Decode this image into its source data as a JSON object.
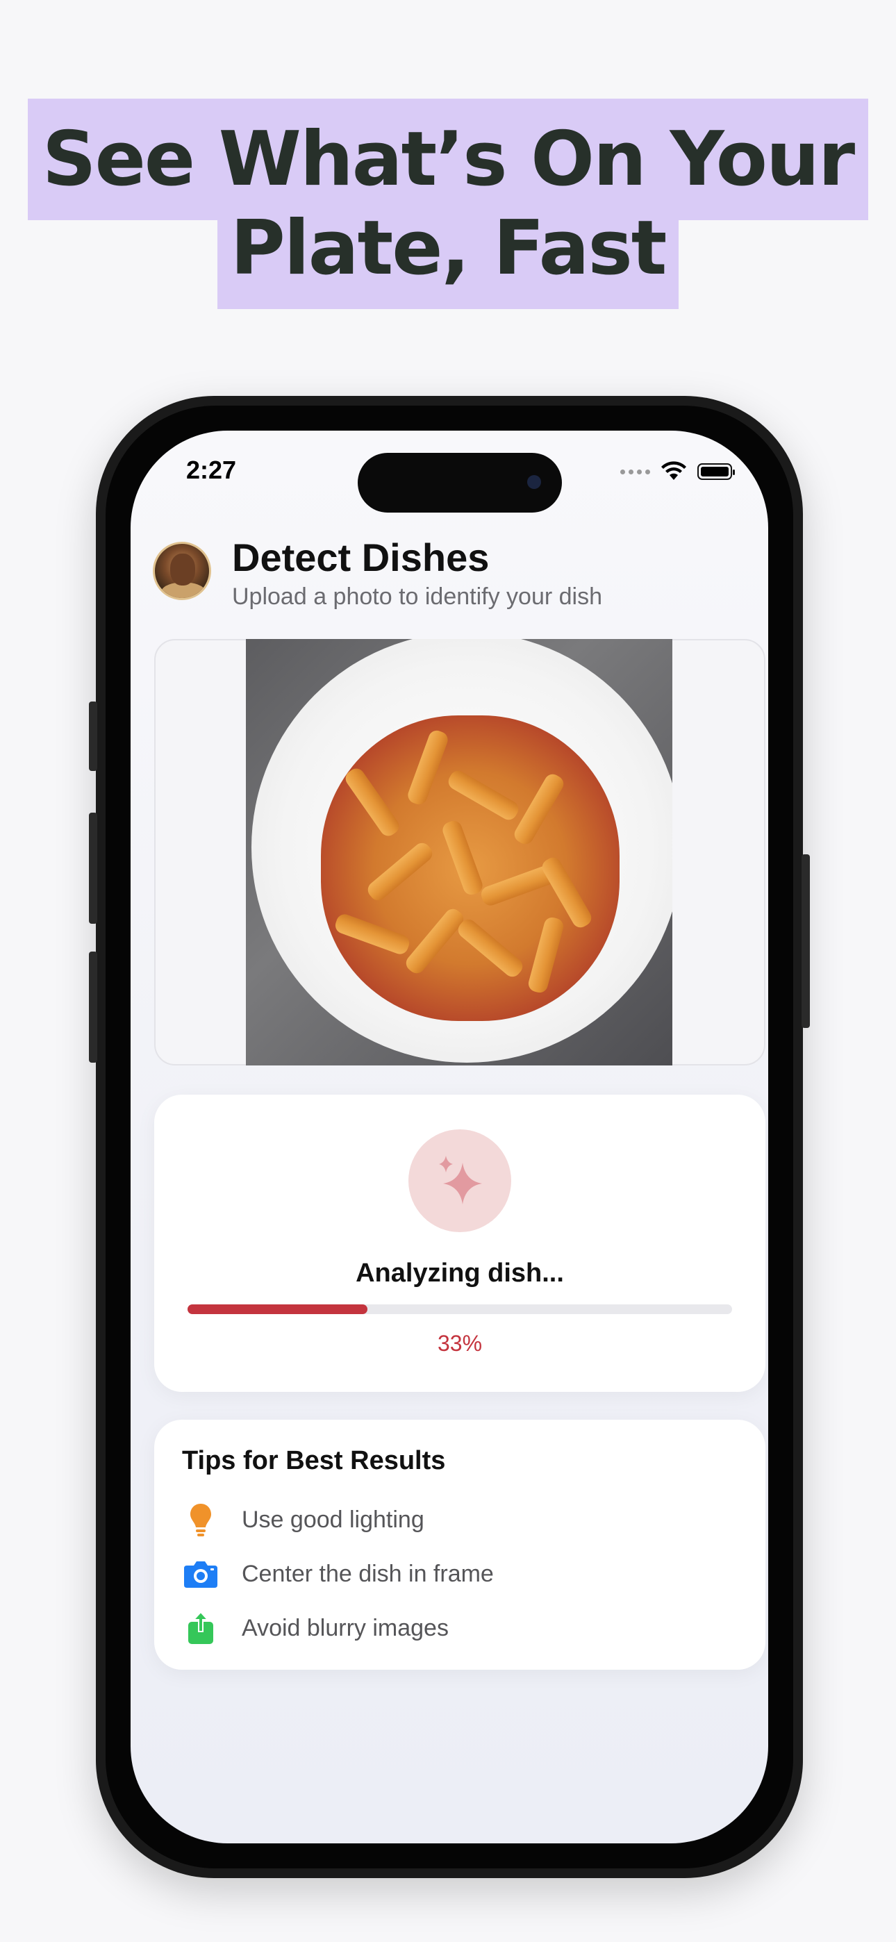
{
  "headline": {
    "line1": "See What’s On Your",
    "line2": "Plate, Fast"
  },
  "status_bar": {
    "time": "2:27"
  },
  "header": {
    "title": "Detect Dishes",
    "subtitle": "Upload a photo to identify your dish"
  },
  "analysis": {
    "status_text": "Analyzing dish...",
    "progress_percent": 33,
    "progress_label": "33%"
  },
  "tips": {
    "title": "Tips for Best Results",
    "items": [
      {
        "icon": "lightbulb-icon",
        "label": "Use good lighting",
        "color": "#f0922a"
      },
      {
        "icon": "camera-icon",
        "label": "Center the dish in frame",
        "color": "#1e7ef5"
      },
      {
        "icon": "share-icon",
        "label": "Avoid blurry images",
        "color": "#35c759"
      }
    ]
  },
  "colors": {
    "accent": "#c4343e",
    "headline_highlight": "#d9cbf6"
  }
}
